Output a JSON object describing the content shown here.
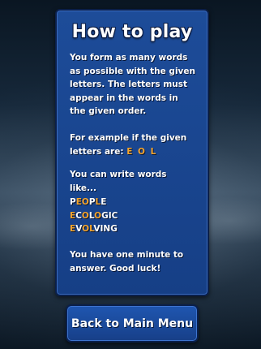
{
  "title": "How to play",
  "intro": "You form as many words as possible with the given letters. The letters must appear in the words in the given order.",
  "example_prefix": "For example if the given letters are:",
  "example_letters": "E O L",
  "can_write": "You can write words like...",
  "words": [
    {
      "parts": [
        "P",
        "EO",
        "P",
        "L",
        "E"
      ],
      "highlight": [
        false,
        true,
        false,
        true,
        false
      ]
    },
    {
      "parts": [
        "E",
        "C",
        "O",
        "",
        "L",
        "OGIC"
      ],
      "highlight": [
        true,
        false,
        true,
        false,
        true,
        false
      ]
    },
    {
      "parts": [
        "E",
        "V",
        "O",
        "L",
        "VING"
      ],
      "highlight": [
        true,
        false,
        true,
        true,
        false
      ]
    }
  ],
  "words_text": [
    "PEOPLE",
    "ECOLOGIC",
    "EVOLVING"
  ],
  "closing": "You have one minute to answer. Good luck!",
  "back_button": "Back to Main Menu",
  "colors": {
    "panel": "#1d4c99",
    "highlight": "#f6a52c",
    "text": "#ffffff"
  }
}
